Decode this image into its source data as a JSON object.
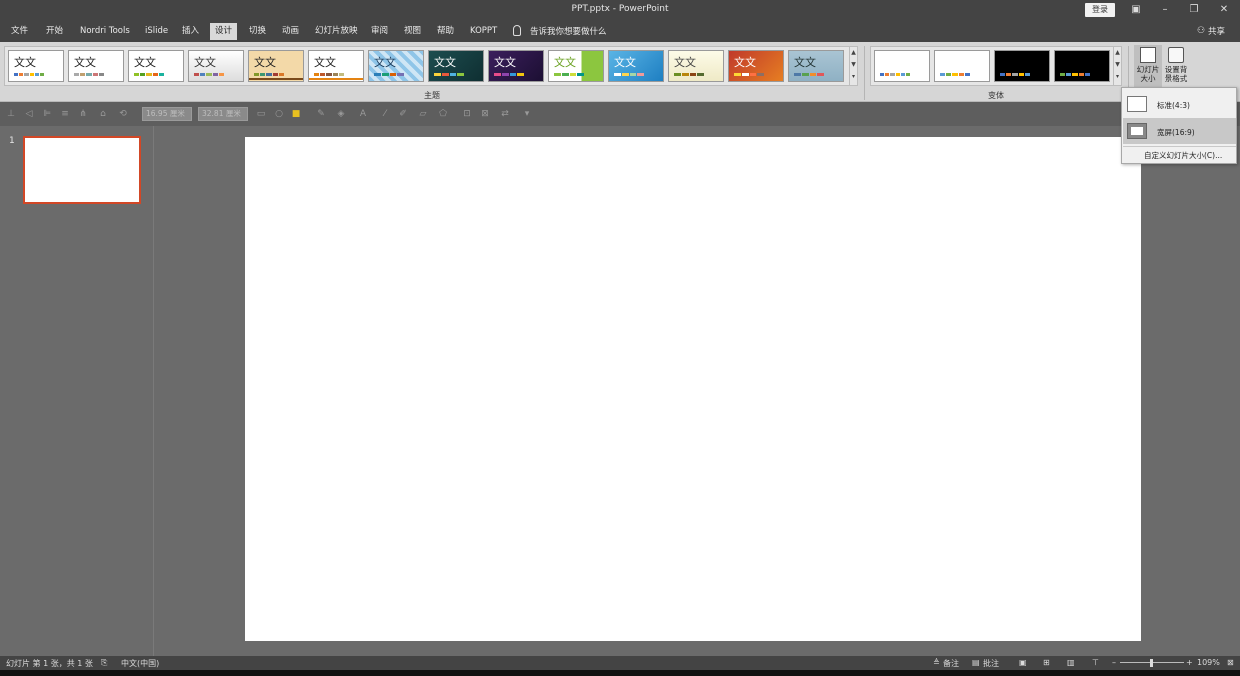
{
  "titlebar": {
    "title": "PPT.pptx  -  PowerPoint",
    "login": "登录",
    "minimize": "–",
    "restore": "❐",
    "close": "✕",
    "ribbon_display": "▣"
  },
  "menu": {
    "tabs": [
      "文件",
      "开始",
      "Nordri Tools",
      "iSlide",
      "插入",
      "设计",
      "切换",
      "动画",
      "幻灯片放映",
      "审阅",
      "视图",
      "帮助",
      "KOPPT"
    ],
    "active": "设计",
    "tellme": "告诉我你想要做什么",
    "share": "共享"
  },
  "ribbon": {
    "themes_group_label": "主题",
    "variants_group_label": "变体",
    "theme_thumb_text": "文文",
    "slide_size_label_1": "幻灯片",
    "slide_size_label_2": "大小",
    "format_bg_label_1": "设置背",
    "format_bg_label_2": "景格式"
  },
  "format_toolbar": {
    "height_value": "16.95 厘米",
    "width_value": "32.81 厘米"
  },
  "thumbnails": {
    "slide_number": "1"
  },
  "dropdown": {
    "items": [
      {
        "label": "标准(4:3)",
        "selected": false
      },
      {
        "label": "宽屏(16:9)",
        "selected": true
      }
    ],
    "custom": "自定义幻灯片大小(C)..."
  },
  "statusbar": {
    "slide_info": "幻灯片 第 1 张，共 1 张",
    "language": "中文(中国)",
    "notes": "备注",
    "comments": "批注",
    "zoom": "109%"
  },
  "colors": {
    "accent_selection": "#d24726",
    "app_bg": "#6b6b6b",
    "titlebar_bg": "#444444"
  }
}
